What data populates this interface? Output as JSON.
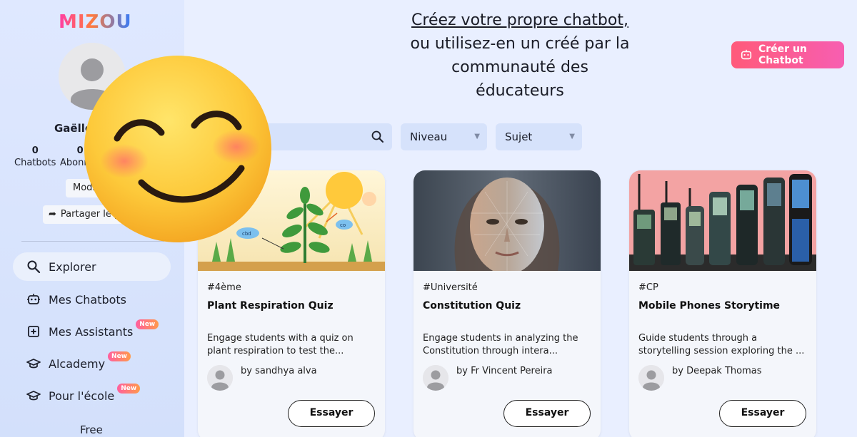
{
  "brand": {
    "logo": "MIZOU"
  },
  "profile": {
    "name": "Gaëlle",
    "stats": [
      {
        "value": "0",
        "label": "Chatbots"
      },
      {
        "value": "0",
        "label": "Abonnés"
      }
    ],
    "modify_label": "Modifier",
    "share_label": "Partager le profil"
  },
  "nav": [
    {
      "label": "Explorer",
      "icon": "search-icon",
      "active": true,
      "new": false
    },
    {
      "label": "Mes Chatbots",
      "icon": "robot-icon",
      "active": false,
      "new": false
    },
    {
      "label": "Mes Assistants",
      "icon": "assistant-icon",
      "active": false,
      "new": true,
      "badge": "New"
    },
    {
      "label": "Alcademy",
      "icon": "graduation-cap-icon",
      "active": false,
      "new": true,
      "badge": "New"
    },
    {
      "label": "Pour l'école",
      "icon": "school-icon",
      "active": false,
      "new": true,
      "badge": "New"
    }
  ],
  "plan": "Free",
  "header": {
    "line1": "Créez votre propre chatbot,",
    "line2": "ou utilisez-en un créé par la",
    "line3": "communauté des",
    "line4": "éducateurs",
    "create_button": "Créer un Chatbot"
  },
  "filters": {
    "search_placeholder": "",
    "niveau": "Niveau",
    "sujet": "Sujet"
  },
  "cards": [
    {
      "tag": "#4ème",
      "title": "Plant Respiration Quiz",
      "description": "Engage students with a quiz on plant respiration to test the...",
      "author": "by sandhya alva",
      "button": "Essayer"
    },
    {
      "tag": "#Université",
      "title": "Constitution Quiz",
      "description": "Engage students in analyzing the Constitution through intera...",
      "author": "by Fr Vincent Pereira",
      "button": "Essayer"
    },
    {
      "tag": "#CP",
      "title": "Mobile Phones Storytime",
      "description": "Guide students through a storytelling session exploring the ...",
      "author": "by Deepak Thomas",
      "button": "Essayer"
    }
  ],
  "thumb_labels": {
    "card1_a": "cbd",
    "card1_b": "co"
  },
  "colors": {
    "accent_gradient_start": "#ff5a7a",
    "accent_gradient_end": "#f75eb1",
    "sidebar_bg": "#dfe8ff",
    "page_bg": "#e9efff"
  }
}
